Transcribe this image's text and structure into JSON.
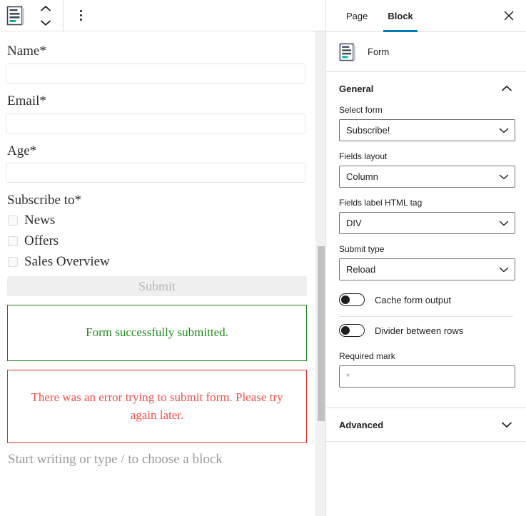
{
  "editor": {
    "toolbar": {
      "block_icon": "form-block-icon",
      "move_up_label": "Move up",
      "move_down_label": "Move down",
      "options_label": "Options"
    },
    "form": {
      "fields": [
        {
          "label": "Name*",
          "value": "",
          "type": "text"
        },
        {
          "label": "Email*",
          "value": "",
          "type": "text"
        },
        {
          "label": "Age*",
          "value": "",
          "type": "text"
        }
      ],
      "checkbox_group_label": "Subscribe to*",
      "checkboxes": [
        {
          "label": "News",
          "checked": false
        },
        {
          "label": "Offers",
          "checked": false
        },
        {
          "label": "Sales Overview",
          "checked": false
        }
      ],
      "submit_label": "Submit",
      "submit_disabled": true,
      "success_message": "Form successfully submitted.",
      "error_message": "There was an error trying to submit form. Please try again later.",
      "success_color": "#1f8a1f",
      "error_color": "#f2504a"
    },
    "placeholder": "Start writing or type / to choose a block"
  },
  "sidebar": {
    "tabs": [
      {
        "label": "Page",
        "active": false
      },
      {
        "label": "Block",
        "active": true
      }
    ],
    "active_tab_color": "#007cba",
    "close_label": "Close settings",
    "block_card": {
      "icon": "form-block-icon",
      "title": "Form"
    },
    "panels": [
      {
        "title": "General",
        "expanded": true
      },
      {
        "title": "Advanced",
        "expanded": false
      }
    ],
    "general": {
      "select_form": {
        "label": "Select form",
        "value": "Subscribe!"
      },
      "fields_layout": {
        "label": "Fields layout",
        "value": "Column"
      },
      "fields_label_html_tag": {
        "label": "Fields label HTML tag",
        "value": "DIV"
      },
      "submit_type": {
        "label": "Submit type",
        "value": "Reload"
      },
      "cache_form_output": {
        "label": "Cache form output",
        "enabled": false
      },
      "divider_between_rows": {
        "label": "Divider between rows",
        "enabled": false
      },
      "required_mark": {
        "label": "Required mark",
        "value": "*"
      }
    }
  }
}
